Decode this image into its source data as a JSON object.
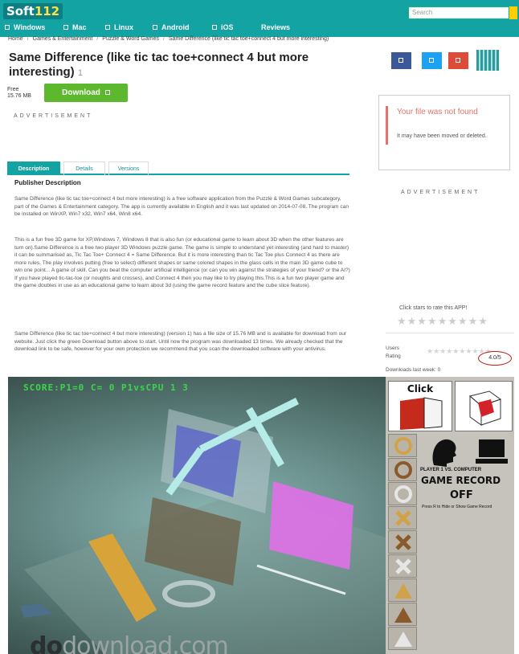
{
  "site": {
    "logo_main": "Soft",
    "logo_num": "112",
    "search_placeholder": "Search"
  },
  "nav": [
    "Windows",
    "Mac",
    "Linux",
    "Android",
    "iOS",
    "Reviews"
  ],
  "breadcrumb": [
    "Home",
    "Games & Entertainment",
    "Puzzle & Word Games",
    "Same Difference (like tic tac toe+connect 4 but more interesting)"
  ],
  "app": {
    "title": "Same Difference (like tic tac toe+connect 4 but more interesting)",
    "title_count": "1",
    "price": "Free",
    "size": "15.76 MB",
    "download_label": "Download"
  },
  "share_colors": [
    "#3b5998",
    "#1da1f2",
    "#dd4b39"
  ],
  "advertisement": "ADVERTISEMENT",
  "notice": {
    "heading": "Your file was not found",
    "body": "It may have been moved or deleted."
  },
  "tabs": [
    "Description",
    "Details",
    "Versions"
  ],
  "description": {
    "heading": "Publisher Description",
    "p1": "Same Difference (like tic tac toe+connect 4 but more interesting) is a free software application from the Puzzle & Word Games subcategory, part of the Games & Entertainment category. The app is currently available in English and it was last updated on 2014-07-08. The program can be installed on WinXP, Win7 x32, Win7 x64, Win8 x64.",
    "p2": "This is a fun free 3D game for XP,Windows 7, Windows 8 that is also fun (or educational game to learn about 3D when the other features are turn on).Same Difference is a free two player 3D Windows puzzle game. The game is simple to understand yet interesting (and hard to master) it can be summarised as, Tic Tac Toe+ Connect 4 = Same Difference. But it is more interesting than tic Tac Toe plus Connect 4 as there are more rules. The play involves putting (free to select) different shapes or same colored shapes in the glass cells in the main 3D game cube to win one point... A game of skill. Can you beat the computer artificial intelligence (or can you win against the strategies of your friend? or the AI?) If you have played tic-tac-toe (or noughts and crosses), and Connect 4 then you may like to try playing this.This is a fun two player game and the game doubles in use as an educational game to learn about 3d (using the game record feature and the cube slice feature).",
    "p3": "Same Difference (like tic tac toe+connect 4 but more interesting) (version 1) has a file size of 15.76 MB and is available for download from our website. Just click the green Download button above to start. Until now the program was downloaded 13 times. We already checked that the download link to be safe, however for your own protection we recommend that you scan the downloaded software with your antivirus."
  },
  "rating": {
    "hint": "Click stars to rate this APP!",
    "stars": "★★★★★★★★★",
    "users_label": "Users",
    "rating_label": "Rating",
    "user_stars": "★★★★★★★★★★",
    "value": "4.0/5",
    "downloads_label": "Downloads last week: 0"
  },
  "game": {
    "hud": "SCORE:P1=0 C= 0 P1vsCPU 1 3",
    "click_label": "Click",
    "players_label": "PLAYER 1 VS. COMPUTER",
    "record_title": "GAME RECORD",
    "record_state": "OFF",
    "record_hint": "Press R to Hide or Show Game Record",
    "watermark_bold": "do",
    "watermark_rest": "download.com"
  }
}
